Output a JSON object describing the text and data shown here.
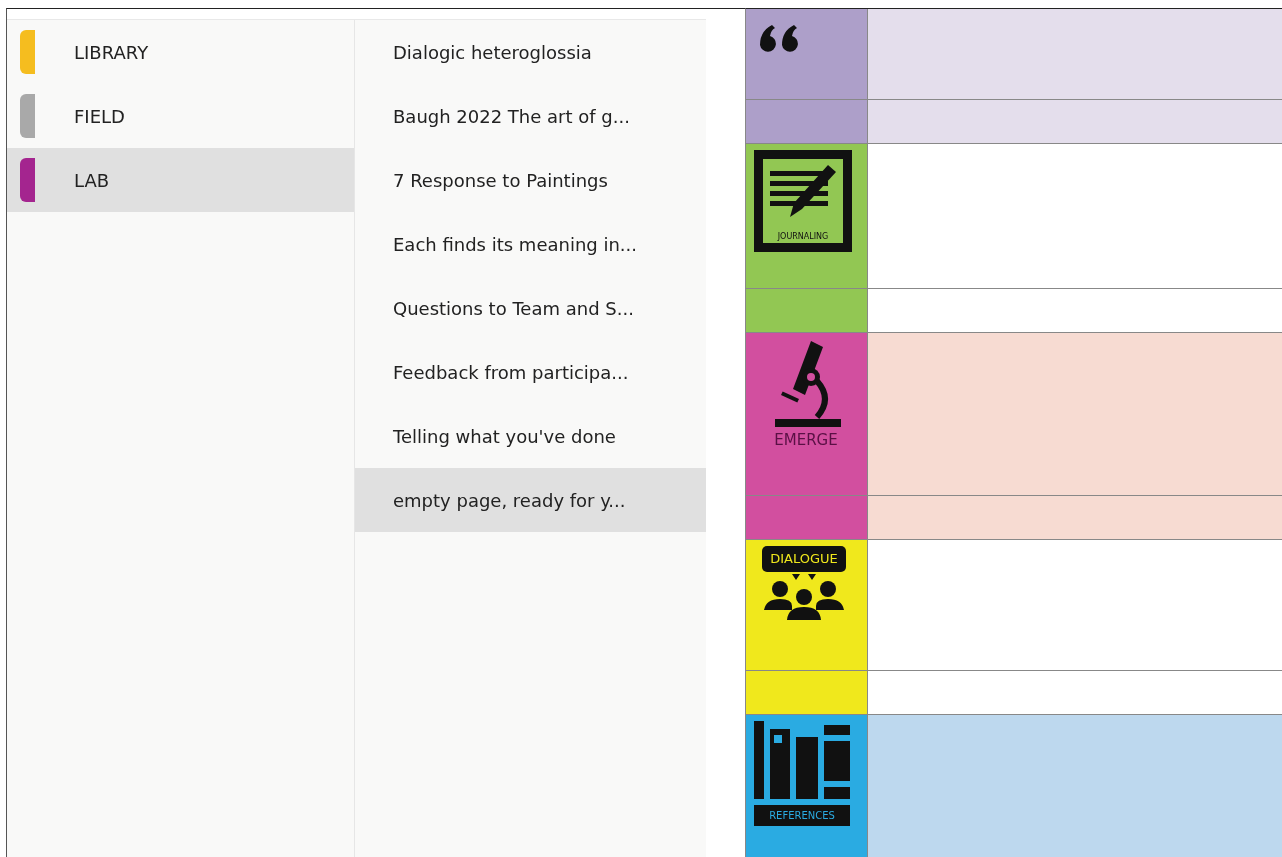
{
  "sections": [
    {
      "label": "LIBRARY",
      "color": "#f5bd1f",
      "selected": false
    },
    {
      "label": "FIELD",
      "color": "#a9a9a9",
      "selected": false
    },
    {
      "label": "LAB",
      "color": "#a4258f",
      "selected": true
    }
  ],
  "pages": [
    {
      "title": "Dialogic heteroglossia",
      "selected": false
    },
    {
      "title": "Baugh 2022 The art of g...",
      "selected": false
    },
    {
      "title": "7 Response to Paintings",
      "selected": false
    },
    {
      "title": "Each finds its meaning in...",
      "selected": false
    },
    {
      "title": "Questions to Team and S...",
      "selected": false
    },
    {
      "title": "Feedback from participa...",
      "selected": false
    },
    {
      "title": "Telling what you've done",
      "selected": false
    },
    {
      "title": "empty page, ready for y...",
      "selected": true
    }
  ],
  "bands": [
    {
      "kind": "quote",
      "color": "#ad9fc9",
      "note": {
        "color": "#e4deec"
      }
    },
    {
      "kind": "journaling",
      "label": "JOURNALING",
      "color": "#92c753",
      "note": {
        "color": "#ffffff"
      }
    },
    {
      "kind": "emerge",
      "label": "EMERGE",
      "color": "#d24f9f",
      "note": {
        "color": "#f7dbd2"
      }
    },
    {
      "kind": "dialogue",
      "label": "DIALOGUE",
      "color": "#f0e81c",
      "note": {
        "color": "#ffffff"
      }
    },
    {
      "kind": "references",
      "label": "REFERENCES",
      "color": "#2aabe2",
      "note": {
        "color": "#bdd8ee"
      }
    }
  ]
}
